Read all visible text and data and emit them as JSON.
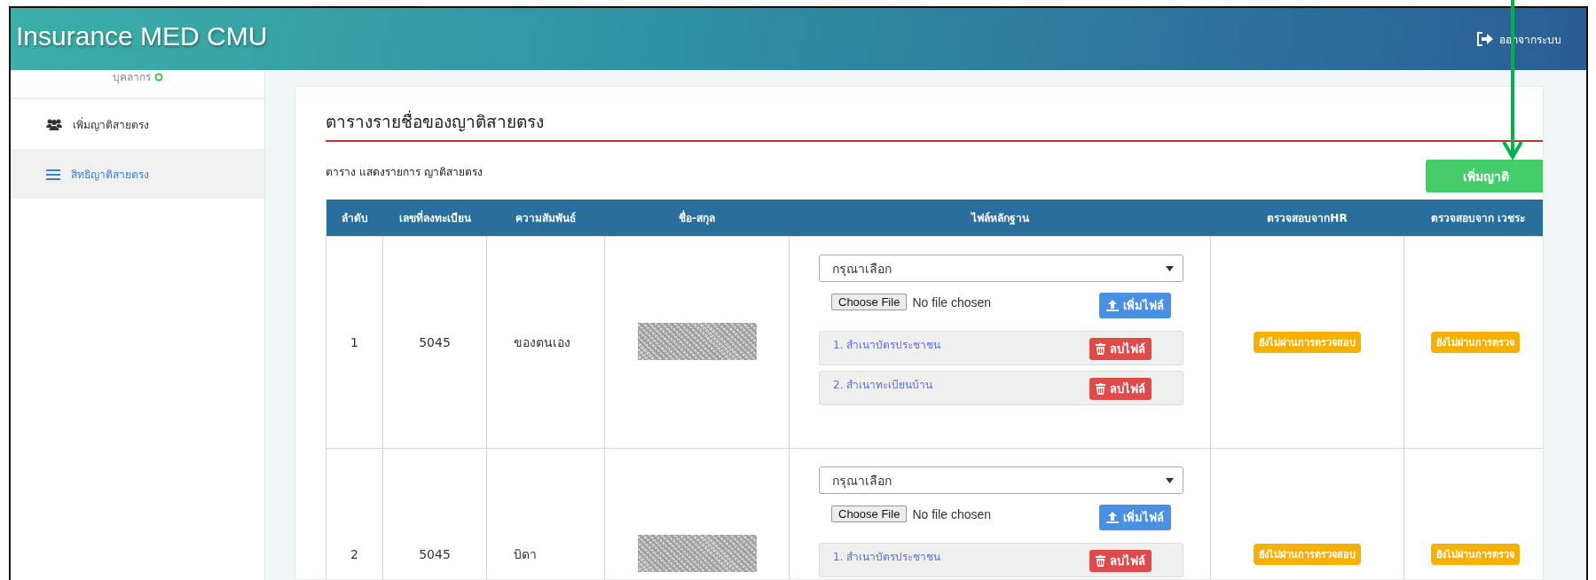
{
  "header": {
    "title": "Insurance MED CMU",
    "logout": "ออกจากระบบ"
  },
  "sidebar": {
    "user_status": "บุคลากร",
    "online": true,
    "items": [
      {
        "label": "เพิ่มญาติสายตรง",
        "selected": false
      },
      {
        "label": "สิทธิญาติสายตรง",
        "selected": true
      }
    ]
  },
  "panel": {
    "title": "ตารางรายชื่อของญาติสายตรง",
    "subtitle": "ตาราง แสดงรายการ ญาติสายตรง",
    "add_button": "เพิ่มญาติ"
  },
  "table": {
    "columns": [
      "ลำดับ",
      "เลขที่ลงทะเบียน",
      "ความสัมพันธ์",
      "ชื่อ-สกุล",
      "ไฟล์หลักฐาน",
      "ตรวจสอบจากHR",
      "ตรวจสอบจาก เวชระ"
    ],
    "rows": [
      {
        "no": "1",
        "reg_no": "5045",
        "relation": "ของตนเอง",
        "name": {
          "kind": "redacted"
        },
        "evidence": {
          "placeholder": "กรุณาเลือก",
          "choose_button": "Choose File",
          "file_status": "No file chosen",
          "upload_button": "เพิ่มไฟล์",
          "files": [
            {
              "name": "1. สำเนาบัตรประชาชน",
              "delete_button": "ลบไฟล์"
            },
            {
              "name": "2. สำเนาทะเบียนบ้าน",
              "delete_button": "ลบไฟล์"
            }
          ]
        },
        "hr_status": "ยังไม่ผ่านการตรวจสอบ",
        "record_status": "ยังไม่ผ่านการตรวจ"
      },
      {
        "no": "2",
        "reg_no": "5045",
        "relation": "บิดา",
        "name": {
          "kind": "redacted"
        },
        "evidence": {
          "placeholder": "กรุณาเลือก",
          "choose_button": "Choose File",
          "file_status": "No file chosen",
          "upload_button": "เพิ่มไฟล์",
          "files": [
            {
              "name": "1. สำเนาบัตรประชาชน",
              "delete_button": "ลบไฟล์"
            }
          ]
        },
        "hr_status": "ยังไม่ผ่านการตรวจสอบ",
        "record_status": "ยังไม่ผ่านการตรวจ"
      }
    ]
  },
  "annotation": {
    "kind": "arrow"
  }
}
